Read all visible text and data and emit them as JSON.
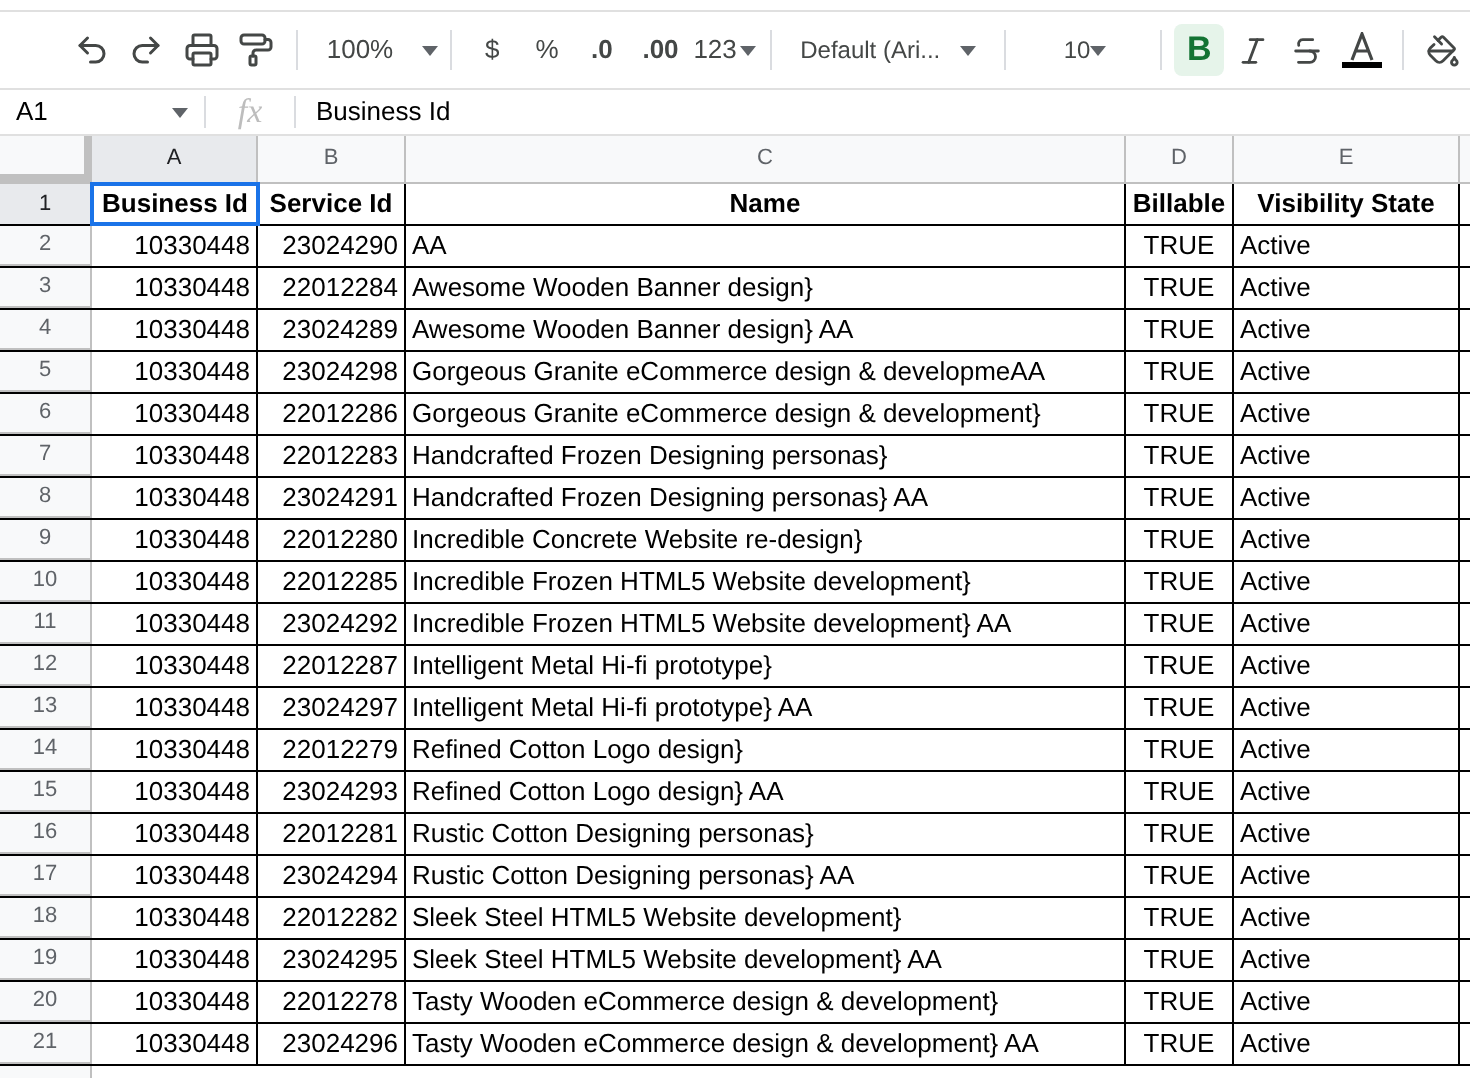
{
  "toolbar": {
    "zoom": "100%",
    "currency": "$",
    "percent": "%",
    "decrease_decimal": ".0",
    "increase_decimal": ".00",
    "number_format": "123",
    "font": "Default (Ari...",
    "font_size": "10",
    "bold_label": "B",
    "bold": true
  },
  "formula_bar": {
    "name_box": "A1",
    "fx": "fx",
    "value": "Business Id"
  },
  "columns": [
    {
      "label": "A",
      "selected": true
    },
    {
      "label": "B",
      "selected": false
    },
    {
      "label": "C",
      "selected": false
    },
    {
      "label": "D",
      "selected": false
    },
    {
      "label": "E",
      "selected": false
    }
  ],
  "header_row": {
    "number": "1",
    "selected": true,
    "cells": [
      {
        "text": "Business Id",
        "selected": true
      },
      {
        "text": "Service Id",
        "selected": false
      },
      {
        "text": "Name",
        "selected": false
      },
      {
        "text": "Billable",
        "selected": false
      },
      {
        "text": "Visibility State",
        "selected": false
      }
    ]
  },
  "rows": [
    {
      "number": "2",
      "cells": [
        "10330448",
        "23024290",
        "AA",
        "TRUE",
        "Active"
      ]
    },
    {
      "number": "3",
      "cells": [
        "10330448",
        "22012284",
        "Awesome Wooden Banner design}",
        "TRUE",
        "Active"
      ]
    },
    {
      "number": "4",
      "cells": [
        "10330448",
        "23024289",
        "Awesome Wooden Banner design} AA",
        "TRUE",
        "Active"
      ]
    },
    {
      "number": "5",
      "cells": [
        "10330448",
        "23024298",
        "Gorgeous Granite eCommerce design & developmeAA",
        "TRUE",
        "Active"
      ]
    },
    {
      "number": "6",
      "cells": [
        "10330448",
        "22012286",
        "Gorgeous Granite eCommerce design & development}",
        "TRUE",
        "Active"
      ]
    },
    {
      "number": "7",
      "cells": [
        "10330448",
        "22012283",
        "Handcrafted Frozen Designing personas}",
        "TRUE",
        "Active"
      ]
    },
    {
      "number": "8",
      "cells": [
        "10330448",
        "23024291",
        "Handcrafted Frozen Designing personas} AA",
        "TRUE",
        "Active"
      ]
    },
    {
      "number": "9",
      "cells": [
        "10330448",
        "22012280",
        "Incredible Concrete Website re-design}",
        "TRUE",
        "Active"
      ]
    },
    {
      "number": "10",
      "cells": [
        "10330448",
        "22012285",
        "Incredible Frozen HTML5 Website development}",
        "TRUE",
        "Active"
      ]
    },
    {
      "number": "11",
      "cells": [
        "10330448",
        "23024292",
        "Incredible Frozen HTML5 Website development} AA",
        "TRUE",
        "Active"
      ]
    },
    {
      "number": "12",
      "cells": [
        "10330448",
        "22012287",
        "Intelligent Metal Hi-fi prototype}",
        "TRUE",
        "Active"
      ]
    },
    {
      "number": "13",
      "cells": [
        "10330448",
        "23024297",
        "Intelligent Metal Hi-fi prototype} AA",
        "TRUE",
        "Active"
      ]
    },
    {
      "number": "14",
      "cells": [
        "10330448",
        "22012279",
        "Refined Cotton Logo design}",
        "TRUE",
        "Active"
      ]
    },
    {
      "number": "15",
      "cells": [
        "10330448",
        "23024293",
        "Refined Cotton Logo design} AA",
        "TRUE",
        "Active"
      ]
    },
    {
      "number": "16",
      "cells": [
        "10330448",
        "22012281",
        "Rustic Cotton Designing personas}",
        "TRUE",
        "Active"
      ]
    },
    {
      "number": "17",
      "cells": [
        "10330448",
        "23024294",
        "Rustic Cotton Designing personas} AA",
        "TRUE",
        "Active"
      ]
    },
    {
      "number": "18",
      "cells": [
        "10330448",
        "22012282",
        "Sleek Steel HTML5 Website development}",
        "TRUE",
        "Active"
      ]
    },
    {
      "number": "19",
      "cells": [
        "10330448",
        "23024295",
        "Sleek Steel HTML5 Website development} AA",
        "TRUE",
        "Active"
      ]
    },
    {
      "number": "20",
      "cells": [
        "10330448",
        "22012278",
        "Tasty Wooden eCommerce design & development}",
        "TRUE",
        "Active"
      ]
    },
    {
      "number": "21",
      "cells": [
        "10330448",
        "23024296",
        "Tasty Wooden eCommerce design & development} AA",
        "TRUE",
        "Active"
      ]
    }
  ]
}
